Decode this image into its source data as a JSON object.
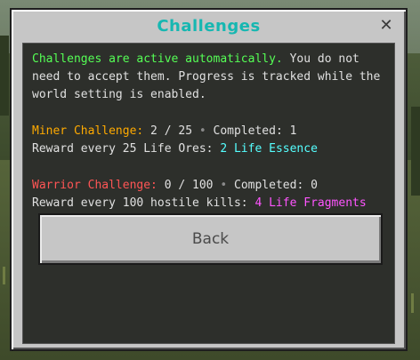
{
  "dialog": {
    "title": "Challenges",
    "close_icon": "close-icon",
    "intro": {
      "highlight": "Challenges are active automatically.",
      "rest_line1": " You do not",
      "line2": "need to accept them. Progress is tracked while the",
      "line3": "world setting is enabled."
    },
    "miner": {
      "name": "Miner Challenge:",
      "progress": " 2 / 25 ",
      "separator": "•",
      "completed": " Completed: 1",
      "reward_label": "Reward every 25 Life Ores: ",
      "reward_value": "2 Life Essence"
    },
    "warrior": {
      "name": "Warrior Challenge:",
      "progress": " 0 / 100 ",
      "separator": "•",
      "completed": " Completed: 0",
      "reward_label": "Reward every 100 hostile kills: ",
      "reward_value": "4 Life Fragments"
    },
    "back_label": "Back"
  },
  "colors": {
    "title": "#16b7b1",
    "highlight": "#55ff55",
    "miner": "#ffaa00",
    "warrior": "#ff5555",
    "essence": "#55ffff",
    "fragments": "#ff55ff"
  }
}
